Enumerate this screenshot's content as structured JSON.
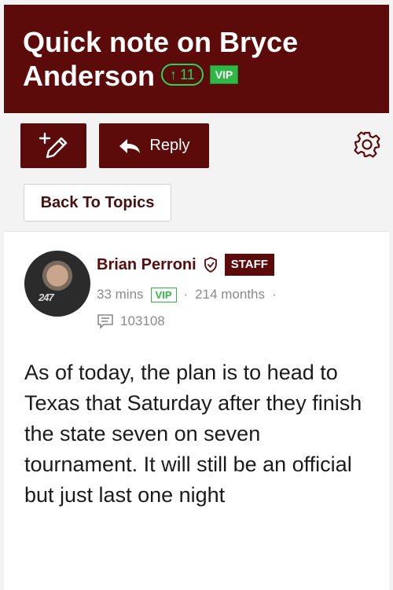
{
  "topic": {
    "title": "Quick note on Bryce Anderson",
    "upvotes": "11",
    "badge": "VIP"
  },
  "toolbar": {
    "new_post_icon": "pencil-plus-icon",
    "reply_label": "Reply",
    "reply_icon": "reply-arrow-icon",
    "settings_icon": "gear-icon"
  },
  "back_label": "Back To Topics",
  "post": {
    "author": "Brian Perroni",
    "author_badge": "STAFF",
    "avatar_text": "247",
    "time": "33 mins",
    "vip": "VIP",
    "member_since": "214 months",
    "post_count": "103108",
    "body": "As of today, the plan is to head to Texas that Saturday after they finish the state seven on seven tournament. It will still be an official but just last one night"
  },
  "colors": {
    "brand": "#5c0a0a",
    "vip_green": "#2fb846",
    "upvote_green": "#27d35c"
  }
}
